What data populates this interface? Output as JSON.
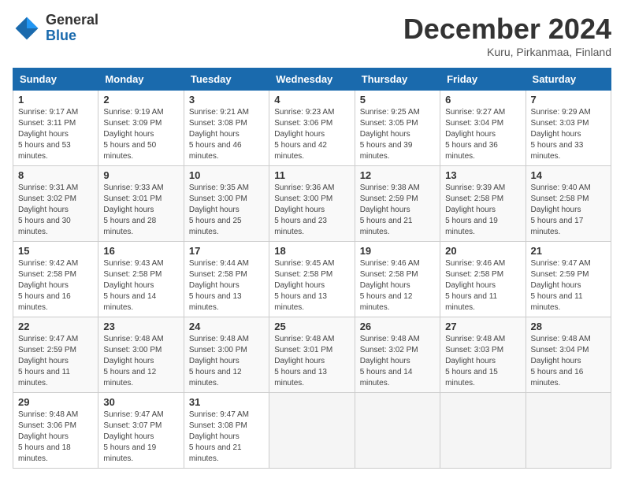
{
  "logo": {
    "general": "General",
    "blue": "Blue"
  },
  "title": "December 2024",
  "location": "Kuru, Pirkanmaa, Finland",
  "days_header": [
    "Sunday",
    "Monday",
    "Tuesday",
    "Wednesday",
    "Thursday",
    "Friday",
    "Saturday"
  ],
  "weeks": [
    [
      {
        "day": "1",
        "sunrise": "9:17 AM",
        "sunset": "3:11 PM",
        "daylight": "5 hours and 53 minutes."
      },
      {
        "day": "2",
        "sunrise": "9:19 AM",
        "sunset": "3:09 PM",
        "daylight": "5 hours and 50 minutes."
      },
      {
        "day": "3",
        "sunrise": "9:21 AM",
        "sunset": "3:08 PM",
        "daylight": "5 hours and 46 minutes."
      },
      {
        "day": "4",
        "sunrise": "9:23 AM",
        "sunset": "3:06 PM",
        "daylight": "5 hours and 42 minutes."
      },
      {
        "day": "5",
        "sunrise": "9:25 AM",
        "sunset": "3:05 PM",
        "daylight": "5 hours and 39 minutes."
      },
      {
        "day": "6",
        "sunrise": "9:27 AM",
        "sunset": "3:04 PM",
        "daylight": "5 hours and 36 minutes."
      },
      {
        "day": "7",
        "sunrise": "9:29 AM",
        "sunset": "3:03 PM",
        "daylight": "5 hours and 33 minutes."
      }
    ],
    [
      {
        "day": "8",
        "sunrise": "9:31 AM",
        "sunset": "3:02 PM",
        "daylight": "5 hours and 30 minutes."
      },
      {
        "day": "9",
        "sunrise": "9:33 AM",
        "sunset": "3:01 PM",
        "daylight": "5 hours and 28 minutes."
      },
      {
        "day": "10",
        "sunrise": "9:35 AM",
        "sunset": "3:00 PM",
        "daylight": "5 hours and 25 minutes."
      },
      {
        "day": "11",
        "sunrise": "9:36 AM",
        "sunset": "3:00 PM",
        "daylight": "5 hours and 23 minutes."
      },
      {
        "day": "12",
        "sunrise": "9:38 AM",
        "sunset": "2:59 PM",
        "daylight": "5 hours and 21 minutes."
      },
      {
        "day": "13",
        "sunrise": "9:39 AM",
        "sunset": "2:58 PM",
        "daylight": "5 hours and 19 minutes."
      },
      {
        "day": "14",
        "sunrise": "9:40 AM",
        "sunset": "2:58 PM",
        "daylight": "5 hours and 17 minutes."
      }
    ],
    [
      {
        "day": "15",
        "sunrise": "9:42 AM",
        "sunset": "2:58 PM",
        "daylight": "5 hours and 16 minutes."
      },
      {
        "day": "16",
        "sunrise": "9:43 AM",
        "sunset": "2:58 PM",
        "daylight": "5 hours and 14 minutes."
      },
      {
        "day": "17",
        "sunrise": "9:44 AM",
        "sunset": "2:58 PM",
        "daylight": "5 hours and 13 minutes."
      },
      {
        "day": "18",
        "sunrise": "9:45 AM",
        "sunset": "2:58 PM",
        "daylight": "5 hours and 13 minutes."
      },
      {
        "day": "19",
        "sunrise": "9:46 AM",
        "sunset": "2:58 PM",
        "daylight": "5 hours and 12 minutes."
      },
      {
        "day": "20",
        "sunrise": "9:46 AM",
        "sunset": "2:58 PM",
        "daylight": "5 hours and 11 minutes."
      },
      {
        "day": "21",
        "sunrise": "9:47 AM",
        "sunset": "2:59 PM",
        "daylight": "5 hours and 11 minutes."
      }
    ],
    [
      {
        "day": "22",
        "sunrise": "9:47 AM",
        "sunset": "2:59 PM",
        "daylight": "5 hours and 11 minutes."
      },
      {
        "day": "23",
        "sunrise": "9:48 AM",
        "sunset": "3:00 PM",
        "daylight": "5 hours and 12 minutes."
      },
      {
        "day": "24",
        "sunrise": "9:48 AM",
        "sunset": "3:00 PM",
        "daylight": "5 hours and 12 minutes."
      },
      {
        "day": "25",
        "sunrise": "9:48 AM",
        "sunset": "3:01 PM",
        "daylight": "5 hours and 13 minutes."
      },
      {
        "day": "26",
        "sunrise": "9:48 AM",
        "sunset": "3:02 PM",
        "daylight": "5 hours and 14 minutes."
      },
      {
        "day": "27",
        "sunrise": "9:48 AM",
        "sunset": "3:03 PM",
        "daylight": "5 hours and 15 minutes."
      },
      {
        "day": "28",
        "sunrise": "9:48 AM",
        "sunset": "3:04 PM",
        "daylight": "5 hours and 16 minutes."
      }
    ],
    [
      {
        "day": "29",
        "sunrise": "9:48 AM",
        "sunset": "3:06 PM",
        "daylight": "5 hours and 18 minutes."
      },
      {
        "day": "30",
        "sunrise": "9:47 AM",
        "sunset": "3:07 PM",
        "daylight": "5 hours and 19 minutes."
      },
      {
        "day": "31",
        "sunrise": "9:47 AM",
        "sunset": "3:08 PM",
        "daylight": "5 hours and 21 minutes."
      },
      null,
      null,
      null,
      null
    ]
  ]
}
